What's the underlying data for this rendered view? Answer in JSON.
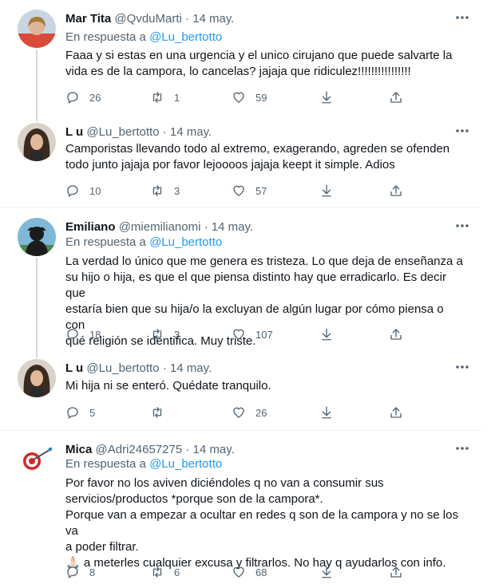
{
  "tweets": [
    {
      "name": "Mar Tita",
      "handle": "@QvduMarti",
      "sep": "·",
      "date": "14 may.",
      "reply_prefix": "En respuesta a",
      "reply_mention": "@Lu_bertotto",
      "lines": [
        "Faaa y si estas en una urgencia y el unico cirujano que puede salvarte la",
        "vida es de la campora, lo cancelas? jajaja que ridiculez!!!!!!!!!!!!!!!!"
      ],
      "replies": "26",
      "retweets": "1",
      "likes": "59"
    },
    {
      "name": "L u",
      "handle": "@Lu_bertotto",
      "sep": "·",
      "date": "14 may.",
      "lines": [
        "Camporistas llevando todo al extremo, exagerando, agreden se ofenden",
        "todo junto jajaja por favor lejoooos jajaja keept it simple.  Adios"
      ],
      "replies": "10",
      "retweets": "3",
      "likes": "57"
    },
    {
      "name": "Emiliano",
      "handle": "@miemilianomi",
      "sep": "·",
      "date": "14 may.",
      "reply_prefix": "En respuesta a",
      "reply_mention": "@Lu_bertotto",
      "lines": [
        "La verdad lo único que me genera es tristeza. Lo que deja de enseñanza a",
        "su hijo o hija, es que el que piensa distinto hay que erradicarlo. Es decir que",
        "estaría bien que su hija/o la excluyan de algún lugar por cómo piensa o con",
        "qué religión se identifica. Muy triste."
      ],
      "replies": "18",
      "retweets": "3",
      "likes": "107"
    },
    {
      "name": "L u",
      "handle": "@Lu_bertotto",
      "sep": "·",
      "date": "14 may.",
      "lines": [
        "Mi hija ni se enteró. Quédate tranquilo."
      ],
      "replies": "5",
      "retweets": "",
      "likes": "26"
    },
    {
      "name": "Mica",
      "handle": "@Adri24657275",
      "sep": "·",
      "date": "14 may.",
      "reply_prefix": "En respuesta a",
      "reply_mention": "@Lu_bertotto",
      "lines": [
        "Por favor no los aviven diciéndoles q no van a consumir sus",
        "servicios/productos *porque son de la campora*.",
        "Porque van a empezar a ocultar en redes q son de la campora y no se los va",
        "a poder filtrar.",
        "🙏🏻 a meterles cualquier excusa y filtrarlos. No hay q ayudarlos con info."
      ],
      "replies": "8",
      "retweets": "6",
      "likes": "68"
    }
  ],
  "icons": {
    "reply": "reply-icon",
    "retweet": "retweet-icon",
    "like": "heart-icon",
    "download": "download-icon",
    "share": "share-icon",
    "more": "more-icon"
  },
  "colors": {
    "text": "#0f1419",
    "muted": "#536471",
    "link": "#1d9bf0",
    "line": "#cfd9de"
  }
}
